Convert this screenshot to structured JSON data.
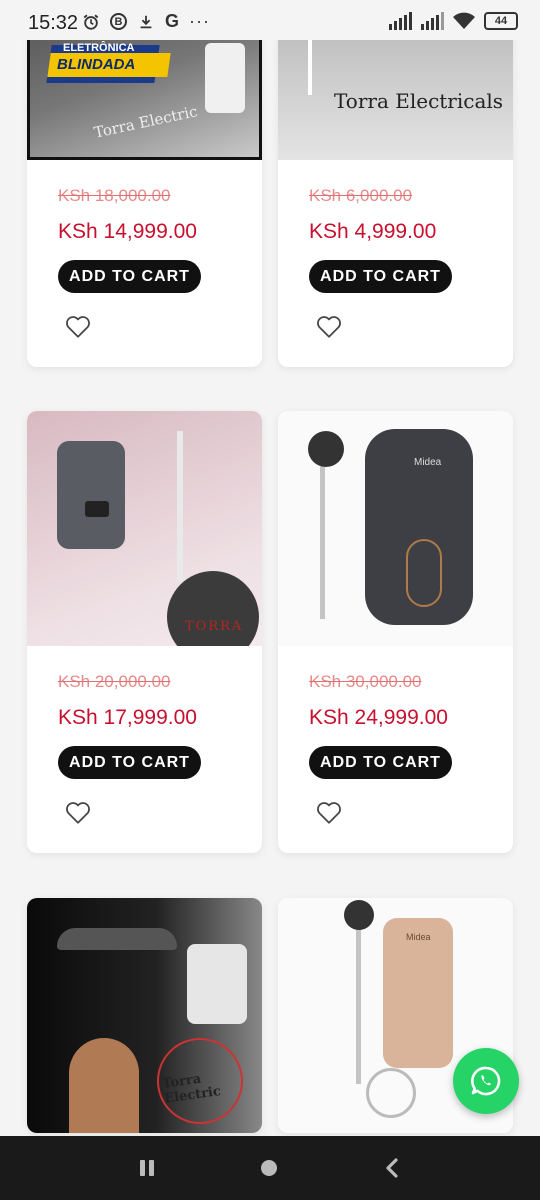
{
  "status_bar": {
    "time": "15:32",
    "battery": "44",
    "icons": [
      "alarm-icon",
      "b-badge-icon",
      "download-icon",
      "google-icon",
      "more-icon",
      "signal-icon",
      "signal-icon",
      "wifi-icon",
      "battery-icon"
    ],
    "b_badge": "B",
    "g_badge": "G",
    "more": "···"
  },
  "products": [
    {
      "image_text": [
        "ELETRÔNICA",
        "BLINDADA",
        "Torra Electric"
      ],
      "old_price": "KSh 18,000.00",
      "new_price": "KSh 14,999.00",
      "cart_label": "ADD TO CART"
    },
    {
      "image_text": [
        "Torra Electricals"
      ],
      "old_price": "KSh 6,000.00",
      "new_price": "KSh 4,999.00",
      "cart_label": "ADD TO CART"
    },
    {
      "image_text": [
        "TORRA"
      ],
      "old_price": "KSh 20,000.00",
      "new_price": "KSh 17,999.00",
      "cart_label": "ADD TO CART"
    },
    {
      "image_text": [
        "Midea"
      ],
      "old_price": "KSh 30,000.00",
      "new_price": "KSh 24,999.00",
      "cart_label": "ADD TO CART"
    },
    {
      "image_text": [
        "Torra Electric"
      ],
      "old_price": "",
      "new_price": "",
      "cart_label": ""
    },
    {
      "image_text": [
        "Midea"
      ],
      "old_price": "",
      "new_price": "",
      "cart_label": ""
    }
  ],
  "colors": {
    "accent_price": "#c8102e",
    "old_price": "#e88888",
    "button_bg": "#111111",
    "whatsapp": "#25d366"
  }
}
